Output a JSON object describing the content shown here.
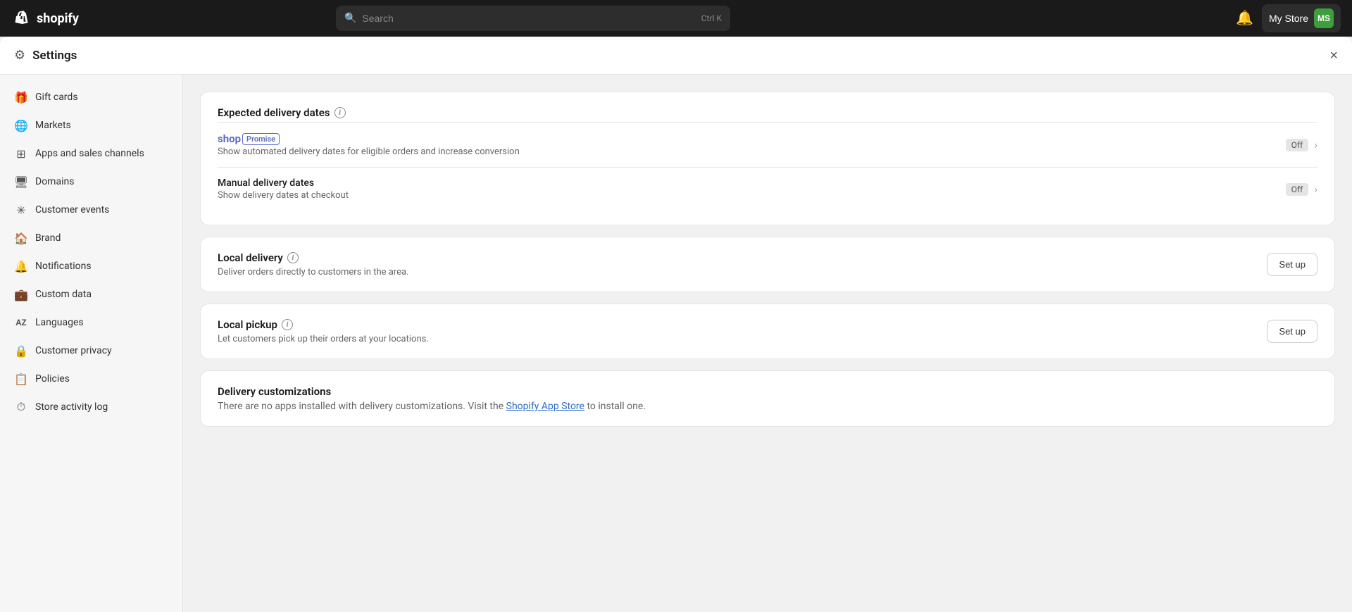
{
  "topbar": {
    "logo_text": "shopify",
    "search_placeholder": "Search",
    "search_shortcut": "Ctrl K",
    "store_name": "My Store",
    "avatar_initials": "MS"
  },
  "settings": {
    "title": "Settings",
    "close_label": "×"
  },
  "sidebar": {
    "items": [
      {
        "id": "gift-cards",
        "label": "Gift cards",
        "icon": "🎁"
      },
      {
        "id": "markets",
        "label": "Markets",
        "icon": "🌐"
      },
      {
        "id": "apps-sales",
        "label": "Apps and sales channels",
        "icon": "⊞"
      },
      {
        "id": "domains",
        "label": "Domains",
        "icon": "🖥"
      },
      {
        "id": "customer-events",
        "label": "Customer events",
        "icon": "✳"
      },
      {
        "id": "brand",
        "label": "Brand",
        "icon": "🏠"
      },
      {
        "id": "notifications",
        "label": "Notifications",
        "icon": "🔔"
      },
      {
        "id": "custom-data",
        "label": "Custom data",
        "icon": "💼"
      },
      {
        "id": "languages",
        "label": "Languages",
        "icon": "AZ"
      },
      {
        "id": "customer-privacy",
        "label": "Customer privacy",
        "icon": "🔒"
      },
      {
        "id": "policies",
        "label": "Policies",
        "icon": "📋"
      },
      {
        "id": "store-activity-log",
        "label": "Store activity log",
        "icon": "⏱"
      }
    ]
  },
  "main": {
    "expected_delivery": {
      "title": "Expected delivery dates",
      "shop_promise": {
        "brand": "shop",
        "badge": "Promise",
        "description": "Show automated delivery dates for eligible orders and increase conversion",
        "status": "Off"
      },
      "manual": {
        "title": "Manual delivery dates",
        "description": "Show delivery dates at checkout",
        "status": "Off"
      }
    },
    "local_delivery": {
      "title": "Local delivery",
      "description": "Deliver orders directly to customers in the area.",
      "button_label": "Set up"
    },
    "local_pickup": {
      "title": "Local pickup",
      "description": "Let customers pick up their orders at your locations.",
      "button_label": "Set up"
    },
    "delivery_customizations": {
      "title": "Delivery customizations",
      "description_pre": "There are no apps installed with delivery customizations. Visit the ",
      "link_text": "Shopify App Store",
      "description_post": " to install one."
    }
  }
}
